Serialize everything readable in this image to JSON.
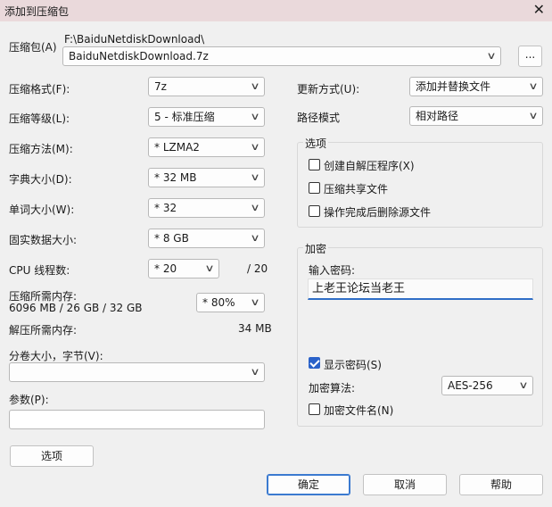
{
  "window": {
    "title": "添加到压缩包",
    "close_glyph": "✕"
  },
  "archive": {
    "label": "压缩包(A)",
    "path": "F:\\BaiduNetdiskDownload\\",
    "filename": "BaiduNetdiskDownload.7z",
    "browse_label": "..."
  },
  "left": {
    "format": {
      "label": "压缩格式(F):",
      "value": "7z"
    },
    "level": {
      "label": "压缩等级(L):",
      "value": "5 - 标准压缩"
    },
    "method": {
      "label": "压缩方法(M):",
      "value": "* LZMA2"
    },
    "dict": {
      "label": "字典大小(D):",
      "value": "* 32 MB"
    },
    "word": {
      "label": "单词大小(W):",
      "value": "* 32"
    },
    "solid": {
      "label": "固实数据大小:",
      "value": "* 8 GB"
    },
    "threads": {
      "label": "CPU 线程数:",
      "value": "* 20",
      "max": "/ 20"
    },
    "mem_compress": {
      "label": "压缩所需内存:",
      "detail": "6096 MB / 26 GB / 32 GB",
      "value": "* 80%"
    },
    "mem_decompress": {
      "label": "解压所需内存:",
      "value": "34 MB"
    },
    "volume": {
      "label": "分卷大小，字节(V):",
      "value": ""
    },
    "params": {
      "label": "参数(P):",
      "value": ""
    },
    "options_button": "选项"
  },
  "right": {
    "update": {
      "label": "更新方式(U):",
      "value": "添加并替换文件"
    },
    "pathmode": {
      "label": "路径模式",
      "value": "相对路径"
    },
    "options": {
      "title": "选项",
      "sfx": {
        "label": "创建自解压程序(X)",
        "checked": false
      },
      "shared": {
        "label": "压缩共享文件",
        "checked": false
      },
      "delete": {
        "label": "操作完成后删除源文件",
        "checked": false
      }
    },
    "encryption": {
      "title": "加密",
      "password_label": "输入密码:",
      "password_value": "上老王论坛当老王",
      "show_password": {
        "label": "显示密码(S)",
        "checked": true
      },
      "method_label": "加密算法:",
      "method_value": "AES-256",
      "encrypt_names": {
        "label": "加密文件名(N)",
        "checked": false
      }
    }
  },
  "buttons": {
    "ok": "确定",
    "cancel": "取消",
    "help": "帮助"
  },
  "icons": {
    "dropdown": "chevron-down-icon",
    "close": "close-icon"
  }
}
